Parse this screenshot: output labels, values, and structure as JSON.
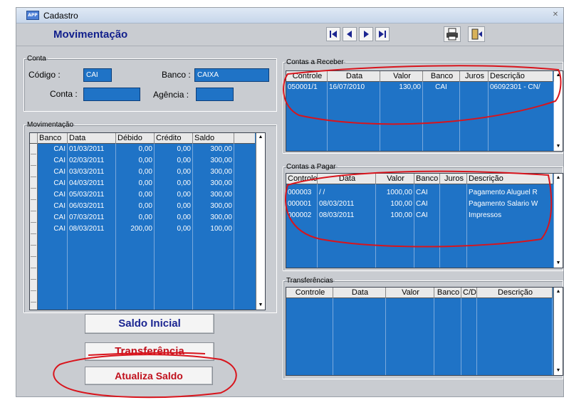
{
  "window": {
    "title": "Cadastro",
    "app_icon": "form-app-icon"
  },
  "toolbar": {
    "form_title": "Movimentação",
    "nav_icons": [
      "first-record-icon",
      "previous-record-icon",
      "next-record-icon",
      "last-record-icon"
    ],
    "tool_icons": [
      "printer-icon",
      "exit-door-icon"
    ]
  },
  "conta": {
    "legend": "Conta",
    "codigo_label": "Código :",
    "codigo_value": "CAI",
    "banco_label": "Banco :",
    "banco_value": "CAIXA",
    "conta_label": "Conta :",
    "conta_value": "",
    "agencia_label": "Agência :",
    "agencia_value": ""
  },
  "movimentacao": {
    "legend": "Movimentação",
    "columns": [
      "Banco",
      "Data",
      "Débido",
      "Crédito",
      "Saldo"
    ],
    "rows": [
      [
        "CAI",
        "01/03/2011",
        "0,00",
        "0,00",
        "300,00"
      ],
      [
        "CAI",
        "02/03/2011",
        "0,00",
        "0,00",
        "300,00"
      ],
      [
        "CAI",
        "03/03/2011",
        "0,00",
        "0,00",
        "300,00"
      ],
      [
        "CAI",
        "04/03/2011",
        "0,00",
        "0,00",
        "300,00"
      ],
      [
        "CAI",
        "05/03/2011",
        "0,00",
        "0,00",
        "300,00"
      ],
      [
        "CAI",
        "06/03/2011",
        "0,00",
        "0,00",
        "300,00"
      ],
      [
        "CAI",
        "07/03/2011",
        "0,00",
        "0,00",
        "300,00"
      ],
      [
        "CAI",
        "08/03/2011",
        "200,00",
        "0,00",
        "100,00"
      ]
    ]
  },
  "buttons": {
    "saldo_inicial": "Saldo Inicial",
    "transferencia": "Transferência",
    "atualiza_saldo": "Atualiza Saldo"
  },
  "receber": {
    "legend": "Contas a Receber",
    "columns": [
      "Controle",
      "Data",
      "Valor",
      "Banco",
      "Juros",
      "Descrição"
    ],
    "rows": [
      [
        "050001/1",
        "16/07/2010",
        "130,00",
        "CAI",
        "",
        "06092301 - CN/"
      ]
    ]
  },
  "pagar": {
    "legend": "Contas a Pagar",
    "columns": [
      "Controle",
      "Data",
      "Valor",
      "Banco",
      "Juros",
      "Descrição"
    ],
    "rows": [
      [
        "000003",
        "/ /",
        "1000,00",
        "CAI",
        "",
        "Pagamento Aluguel R"
      ],
      [
        "000001",
        "08/03/2011",
        "100,00",
        "CAI",
        "",
        "Pagamento Salario W"
      ],
      [
        "000002",
        "08/03/2011",
        "100,00",
        "CAI",
        "",
        "Impressos"
      ]
    ]
  },
  "transferencias": {
    "legend": "Transferências",
    "columns": [
      "Controle",
      "Data",
      "Valor",
      "Banco",
      "C/D",
      "Descrição"
    ],
    "rows": []
  },
  "colors": {
    "grid_blue": "#1f73c6",
    "annotation_red": "#d8141c",
    "title_navy": "#12208c"
  }
}
